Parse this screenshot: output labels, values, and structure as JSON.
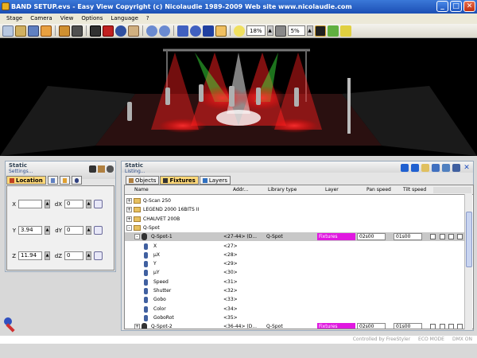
{
  "window": {
    "title": "BAND SETUP.evs - Easy View   Copyright (c) Nicolaudie 1989-2009    Web site www.nicolaudie.com",
    "minimize": "_",
    "maximize": "□",
    "close": "✕"
  },
  "menu": [
    "Stage",
    "Camera",
    "View",
    "Options",
    "Language",
    "?"
  ],
  "toolbar": {
    "zoom_value": "18%",
    "grid_value": "5%",
    "icons": [
      "new-icon",
      "open-icon",
      "save-icon",
      "hand-icon",
      "paint-icon",
      "camera-icon",
      "dmx-icon",
      "truss-icon",
      "sphere-icon",
      "cube-icon",
      "undo-icon",
      "redo-icon",
      "select-icon",
      "rotate-icon",
      "move-icon",
      "scale-icon",
      "light-icon",
      "grid-icon",
      "render-icon",
      "brush-icon"
    ]
  },
  "left_panel": {
    "header_line1": "Static",
    "header_line2": "Settings...",
    "tabs": [
      "Location"
    ],
    "fields": {
      "x_label": "X",
      "x_value": "",
      "dx_label": "dX",
      "dx_value": "0",
      "y_label": "Y",
      "y_value": "3.94",
      "dy_label": "dY",
      "dy_value": "0",
      "z_label": "Z",
      "z_value": "11.94",
      "dz_label": "dZ",
      "dz_value": "0"
    }
  },
  "right_panel": {
    "header_line1": "Static",
    "header_line2": "Listing...",
    "tabs": [
      "Objects",
      "Fixtures",
      "Layers"
    ],
    "active_tab": "Fixtures",
    "columns": [
      "Name",
      "Addr...",
      "Library type",
      "Layer",
      "Pan speed",
      "Tilt speed"
    ],
    "rows": [
      {
        "name": "Q-Scan 250",
        "kind": "folder",
        "expand": "+"
      },
      {
        "name": "LEGEND 2000 16BITS II",
        "kind": "folder",
        "expand": "+"
      },
      {
        "name": "CHAUVET 200B",
        "kind": "folder",
        "expand": "+"
      },
      {
        "name": "Q-Spot",
        "kind": "folder",
        "expand": "-"
      },
      {
        "name": "Q-Spot-1",
        "addr": "<27-44> (D...",
        "lib": "Q-Spot",
        "layer": "Fixtures",
        "pan": "02s00",
        "tilt": "01s00",
        "kind": "fixture",
        "selected": true,
        "expand": "-"
      },
      {
        "name": "X",
        "addr": "<27>",
        "kind": "channel"
      },
      {
        "name": "µX",
        "addr": "<28>",
        "kind": "channel"
      },
      {
        "name": "Y",
        "addr": "<29>",
        "kind": "channel"
      },
      {
        "name": "µY",
        "addr": "<30>",
        "kind": "channel"
      },
      {
        "name": "Speed",
        "addr": "<31>",
        "kind": "channel"
      },
      {
        "name": "Shutter",
        "addr": "<32>",
        "kind": "channel"
      },
      {
        "name": "Gobo",
        "addr": "<33>",
        "kind": "channel"
      },
      {
        "name": "Color",
        "addr": "<34>",
        "kind": "channel"
      },
      {
        "name": "GoboRot",
        "addr": "<35>",
        "kind": "channel"
      },
      {
        "name": "Q-Spot-2",
        "addr": "<36-44> (D...",
        "lib": "Q-Spot",
        "layer": "Fixtures",
        "pan": "02s00",
        "tilt": "01s00",
        "kind": "fixture",
        "expand": "+"
      }
    ]
  },
  "status": {
    "controlled": "Controlled by FreeStyler",
    "eco": "ECO MODE",
    "dmx": "DMX ON"
  },
  "colors": {
    "layer_magenta": "#e018e0",
    "title_blue": "#1c4fb4",
    "active_tab": "#ffd878"
  }
}
